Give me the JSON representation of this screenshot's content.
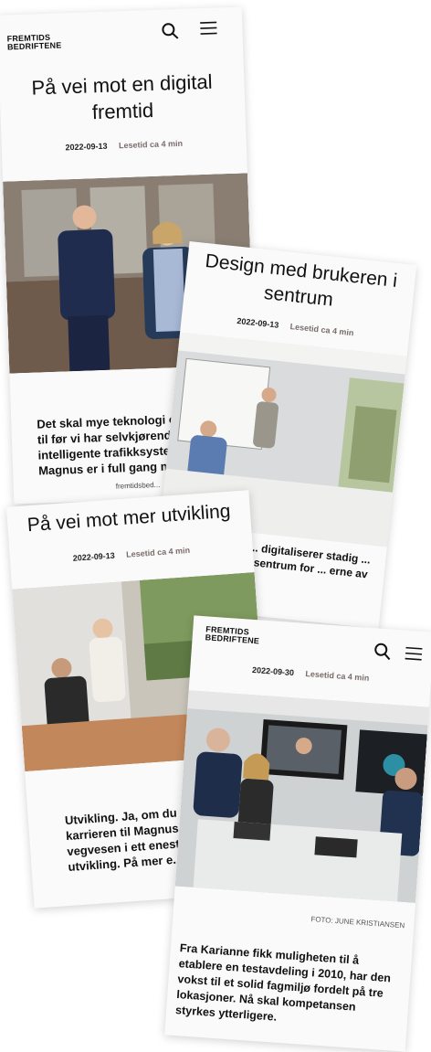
{
  "cards": [
    {
      "logo": [
        "FREMTIDS",
        "BEDRIFTENE"
      ],
      "title": "På vei mot en digital fremtid",
      "date": "2022-09-13",
      "read_time": "Lesetid ca 4 min",
      "excerpt": "Det skal mye teknologi og samarbeid til før vi har selvkjørende biler og intelligente trafikksystemer, men Magnus er i full gang med jobben.",
      "source": "fremtidsbed..."
    },
    {
      "title": "Design med brukeren i sentrum",
      "date": "2022-09-13",
      "read_time": "Lesetid ca 4 min",
      "excerpt": "... digitaliserer stadig ... I sentrum for ... erne av"
    },
    {
      "title": "På vei mot mer utvikling",
      "date": "2022-09-13",
      "read_time": "Lesetid ca 4 min",
      "excerpt": "Utvikling. Ja, om du ... karrieren til Magnus ... vegvesen i ett enest... utvikling. På mer e..."
    },
    {
      "logo": [
        "FREMTIDS",
        "BEDRIFTENE"
      ],
      "date": "2022-09-30",
      "read_time": "Lesetid ca 4 min",
      "photo_credit": "FOTO: JUNE KRISTIANSEN",
      "excerpt": "Fra Karianne fikk muligheten til å etablere en testavdeling i 2010, har den vokst til et solid fagmiljø fordelt på tre lokasjoner. Nå skal kompetansen styrkes ytterligere."
    }
  ],
  "icons": {
    "search": "search-icon",
    "menu": "hamburger-menu-icon"
  }
}
